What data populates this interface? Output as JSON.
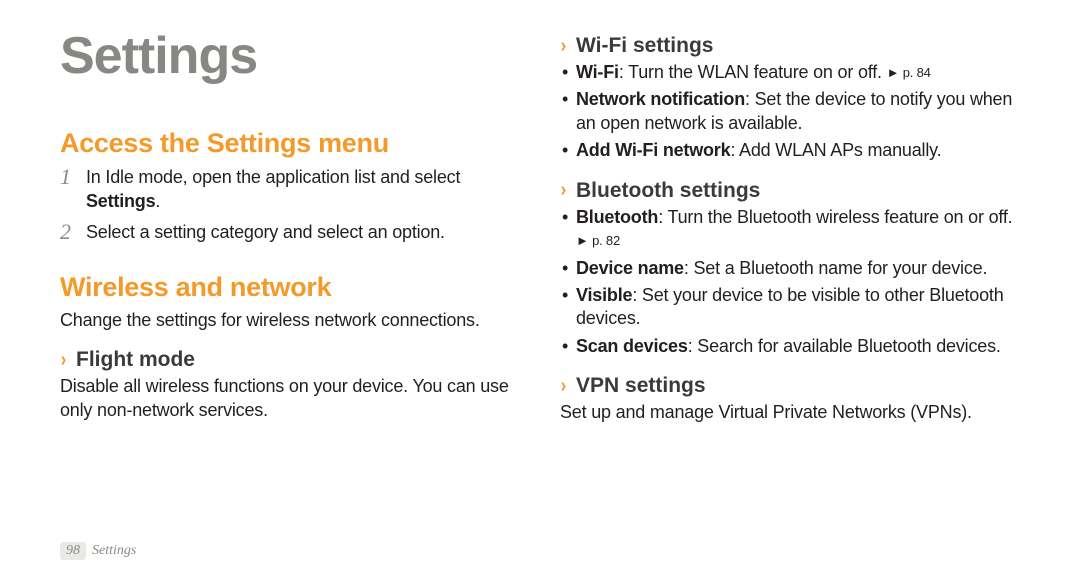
{
  "title": "Settings",
  "left": {
    "access": {
      "heading": "Access the Settings menu",
      "steps": [
        {
          "num": "1",
          "pre": "In Idle mode, open the application list and select ",
          "bold": "Settings",
          "post": "."
        },
        {
          "num": "2",
          "pre": "Select a setting category and select an option.",
          "bold": "",
          "post": ""
        }
      ]
    },
    "wireless": {
      "heading": "Wireless and network",
      "intro": "Change the settings for wireless network connections."
    },
    "flight": {
      "heading": "Flight mode",
      "body": "Disable all wireless functions on your device. You can use only non-network services."
    }
  },
  "right": {
    "wifi": {
      "heading": "Wi-Fi settings",
      "items": [
        {
          "bold": "Wi-Fi",
          "text": ": Turn the WLAN feature on or off. ",
          "ref": "► p. 84"
        },
        {
          "bold": "Network notification",
          "text": ": Set the device to notify you when an open network is available.",
          "ref": ""
        },
        {
          "bold": "Add Wi-Fi network",
          "text": ": Add WLAN APs manually.",
          "ref": ""
        }
      ]
    },
    "bluetooth": {
      "heading": "Bluetooth settings",
      "items": [
        {
          "bold": "Bluetooth",
          "text": ": Turn the Bluetooth wireless feature on or off. ",
          "ref": "► p. 82"
        },
        {
          "bold": "Device name",
          "text": ": Set a Bluetooth name for your device.",
          "ref": ""
        },
        {
          "bold": "Visible",
          "text": ": Set your device to be visible to other Bluetooth devices.",
          "ref": ""
        },
        {
          "bold": "Scan devices",
          "text": ": Search for available Bluetooth devices.",
          "ref": ""
        }
      ]
    },
    "vpn": {
      "heading": "VPN settings",
      "body": "Set up and manage Virtual Private Networks (VPNs)."
    }
  },
  "footer": {
    "page": "98",
    "section": "Settings"
  },
  "chevron_glyph": "›"
}
